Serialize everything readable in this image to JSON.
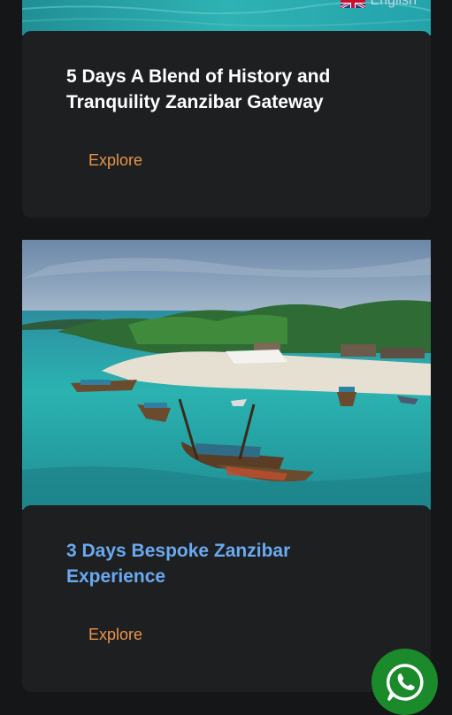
{
  "language": {
    "label": "English"
  },
  "tours": [
    {
      "title": "5 Days A Blend of History and Tranquility Zanzibar Gateway",
      "explore_label": "Explore"
    },
    {
      "title": "3 Days Bespoke Zanzibar Experience",
      "explore_label": "Explore"
    }
  ],
  "colors": {
    "page_bg": "#151617",
    "card_bg": "#1e1f21",
    "title_white": "#ffffff",
    "title_link": "#6aaaf0",
    "explore": "#e8954a",
    "whatsapp": "#1b8a2b"
  },
  "whatsapp": {
    "icon": "whatsapp-icon"
  }
}
